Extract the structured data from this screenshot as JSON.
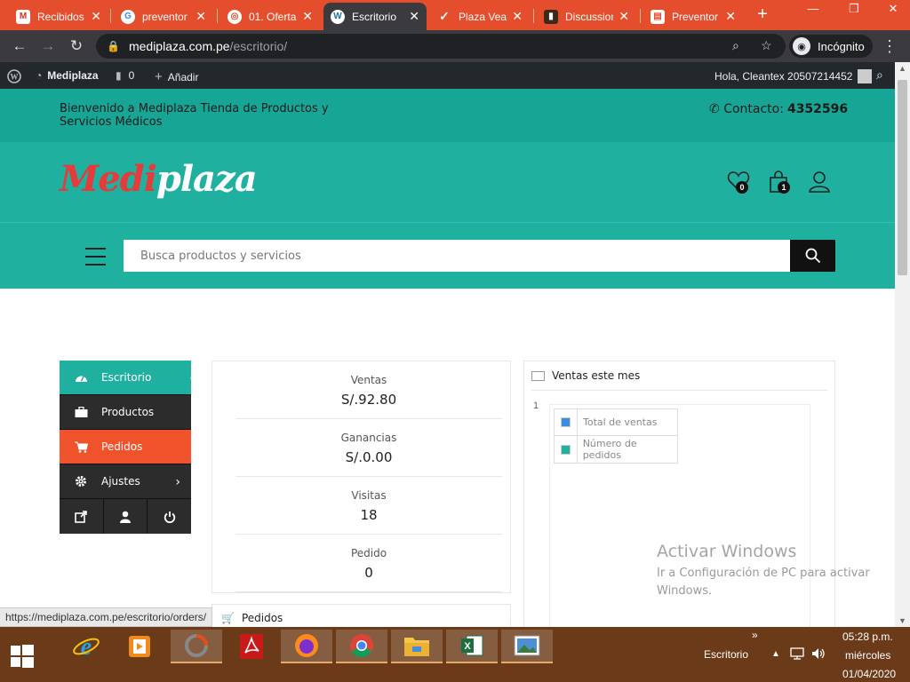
{
  "browser": {
    "tabs": [
      {
        "title": "Recibidos",
        "icon": "gmail-icon"
      },
      {
        "title": "preventor",
        "icon": "google-icon"
      },
      {
        "title": "01. Oferta",
        "icon": "globe-icon"
      },
      {
        "title": "Escritorio",
        "icon": "wordpress-icon"
      },
      {
        "title": "Plaza Vea",
        "icon": "check-icon"
      },
      {
        "title": "Discussion",
        "icon": "book-icon"
      },
      {
        "title": "Preventor",
        "icon": "docs-icon"
      }
    ],
    "url_host": "mediplaza.com.pe",
    "url_path": "/escritorio/",
    "incognito_label": "Incógnito"
  },
  "wpbar": {
    "site_name": "Mediplaza",
    "comments_count": "0",
    "add_label": "Añadir",
    "greeting": "Hola, Cleantex 20507214452"
  },
  "site": {
    "welcome": "Bienvenido a Mediplaza Tienda de Productos y Servicios Médicos",
    "contact_label": "Contacto:",
    "contact_number": "4352596",
    "logo_part1": "Medi",
    "logo_part2": "plaza",
    "wishlist_count": "0",
    "cart_count": "1",
    "search_placeholder": "Busca productos y servicios"
  },
  "sidebar": {
    "items": [
      {
        "label": "Escritorio"
      },
      {
        "label": "Productos"
      },
      {
        "label": "Pedidos"
      },
      {
        "label": "Ajustes"
      }
    ]
  },
  "stats": [
    {
      "label": "Ventas",
      "value": "S/.92.80"
    },
    {
      "label": "Ganancias",
      "value": "S/.0.00"
    },
    {
      "label": "Visitas",
      "value": "18"
    },
    {
      "label": "Pedido",
      "value": "0"
    }
  ],
  "orders_card": {
    "title": "Pedidos"
  },
  "chart_card": {
    "title": "Ventas este mes",
    "y_tick": "1",
    "legend": [
      {
        "label": "Total de ventas",
        "color": "#3c8dde"
      },
      {
        "label": "Número de pedidos",
        "color": "#1fb0a0"
      }
    ]
  },
  "watermark": {
    "title": "Activar Windows",
    "subtitle": "Ir a Configuración de PC para activar Windows."
  },
  "status_url": "https://mediplaza.com.pe/escritorio/orders/",
  "taskbar": {
    "apps": [
      "ie-icon",
      "media-player-icon",
      "recorder-icon",
      "acrobat-icon",
      "firefox-icon",
      "chrome-icon",
      "file-explorer-icon",
      "excel-icon",
      "photos-icon"
    ],
    "desktop_label": "Escritorio",
    "time": "05:28 p.m.",
    "day": "miércoles",
    "date": "01/04/2020"
  },
  "colors": {
    "teal": "#1fb0a0",
    "teal_dark": "#17a596",
    "orange": "#f0532c",
    "logo_red": "#e73a3a",
    "tab_orange": "#e44e2c"
  }
}
